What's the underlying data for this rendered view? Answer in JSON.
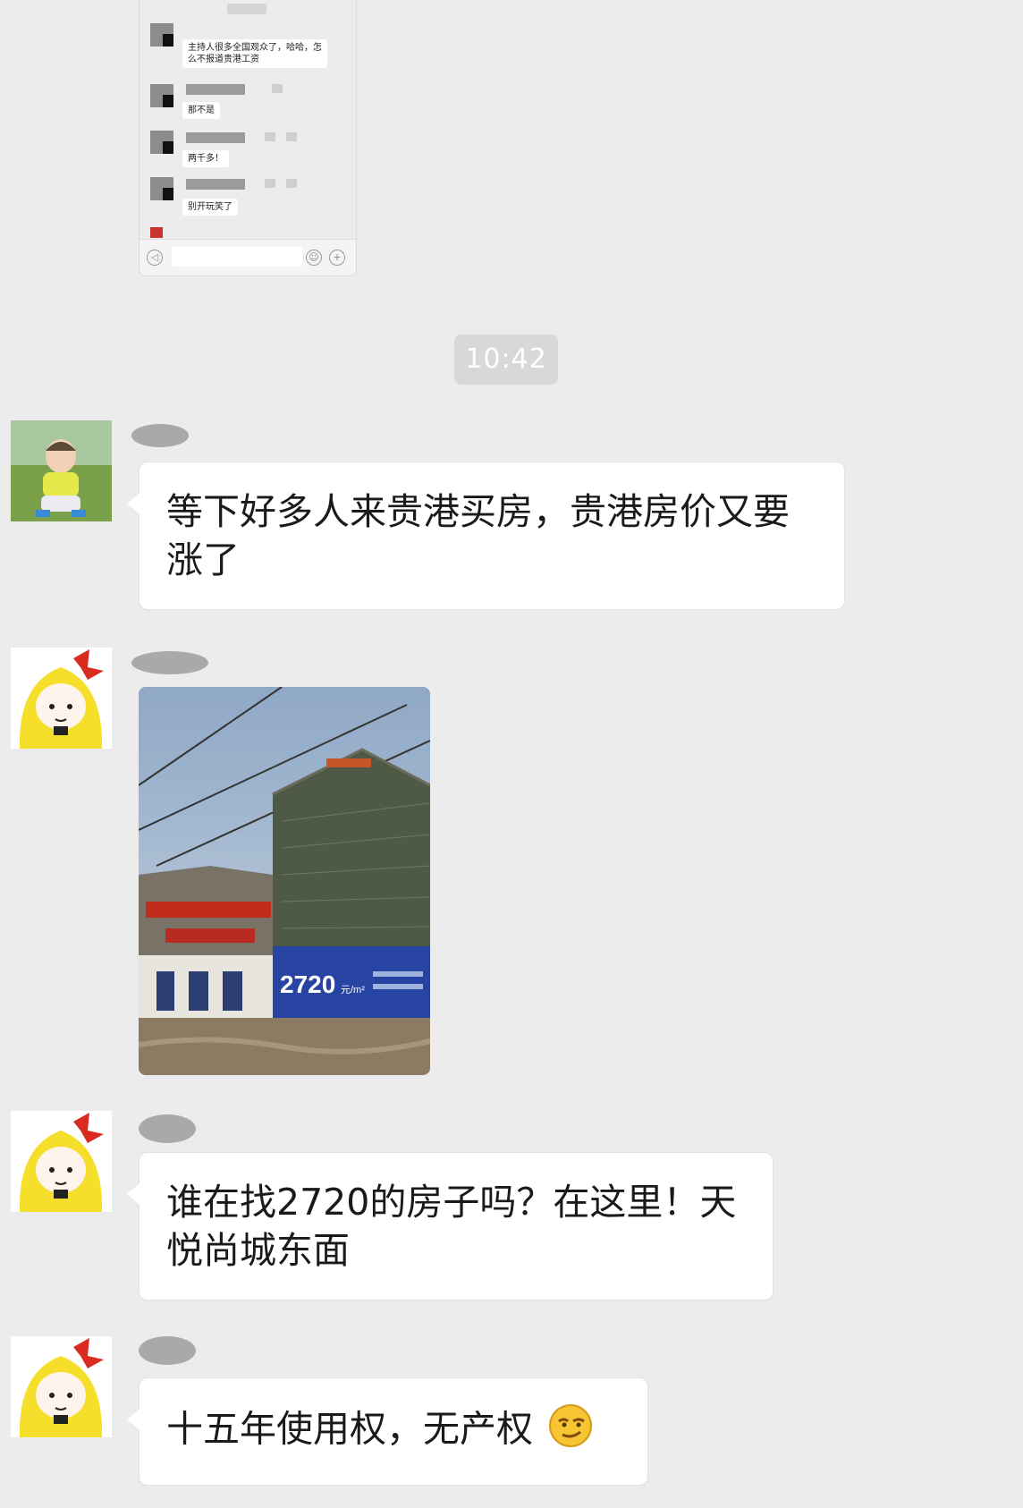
{
  "embedded_chat": {
    "messages": [
      {
        "text": "主持人很多全国观众了，哈哈，怎么不报道贵港工资"
      },
      {
        "text": "那不是"
      },
      {
        "text": "两千多！"
      },
      {
        "text": "别开玩笑了"
      }
    ]
  },
  "timestamp": "10:42",
  "messages": [
    {
      "text": "等下好多人来贵港买房，贵港房价又要涨了"
    },
    {
      "type": "image",
      "caption_text": "2720",
      "caption_unit": "元/m²"
    },
    {
      "text": "谁在找2720的房子吗？在这里！天悦尚城东面"
    },
    {
      "text": "十五年使用权，无产权",
      "emoji": "smirk-emoji"
    }
  ],
  "colors": {
    "background": "#ececec",
    "bubble": "#ffffff",
    "timestamp_bg": "#d8d8d8"
  }
}
